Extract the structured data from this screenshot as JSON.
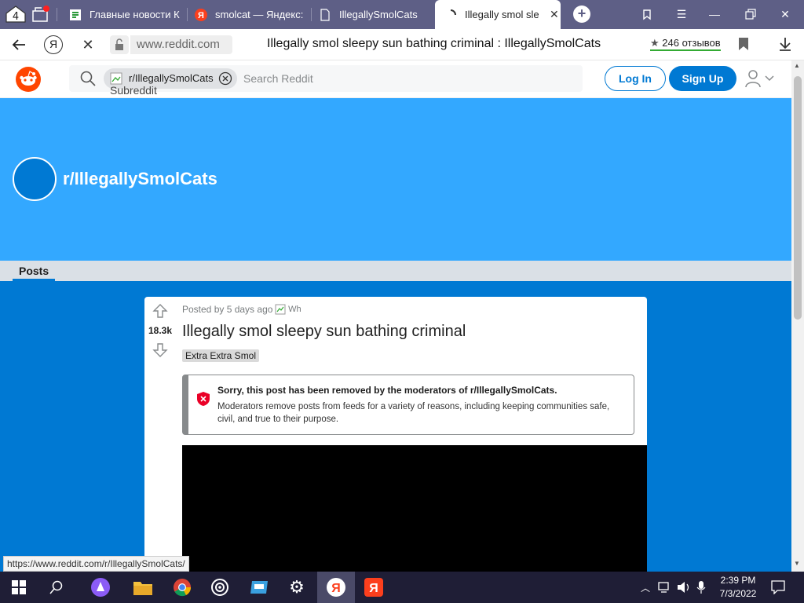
{
  "browser": {
    "tab_count": "4",
    "tabs": [
      {
        "label": "Главные новости К",
        "icon": "news-icon"
      },
      {
        "label": "smolcat — Яндекс:",
        "icon": "yandex-icon"
      },
      {
        "label": "IllegallySmolCats",
        "icon": "page-icon"
      },
      {
        "label": "Illegally smol sle",
        "icon": "loading-spinner-icon"
      }
    ],
    "new_tab_symbol": "+",
    "url": "www.reddit.com",
    "page_title": "Illegally smol sleepy sun bathing criminal : IllegallySmolCats",
    "reviews": "246 отзывов"
  },
  "reddit_header": {
    "subreddit_chip": "r/IllegallySmolCats",
    "broken_image_alt": "Subreddit Icon",
    "search_placeholder": "Search Reddit",
    "login_label": "Log In",
    "signup_label": "Sign Up"
  },
  "subreddit": {
    "name": "r/IllegallySmolCats",
    "nav_tab": "Posts"
  },
  "post": {
    "votes": "18.3k",
    "meta": "Posted by 5 days ago",
    "award_alt": "Wh",
    "title": "Illegally smol sleepy sun bathing criminal",
    "flair": "Extra Extra Smol",
    "removed_title": "Sorry, this post has been removed by the moderators of r/IllegallySmolCats.",
    "removed_body": "Moderators remove posts from feeds for a variety of reasons, including keeping communities safe, civil, and true to their purpose."
  },
  "status_url": "https://www.reddit.com/r/IllegallySmolCats/",
  "taskbar": {
    "time": "2:39 PM",
    "date": "7/3/2022"
  },
  "colors": {
    "reddit_orange": "#ff4500",
    "reddit_blue": "#0079d3",
    "banner_blue": "#33a8ff",
    "removed_red": "#ea0027"
  }
}
